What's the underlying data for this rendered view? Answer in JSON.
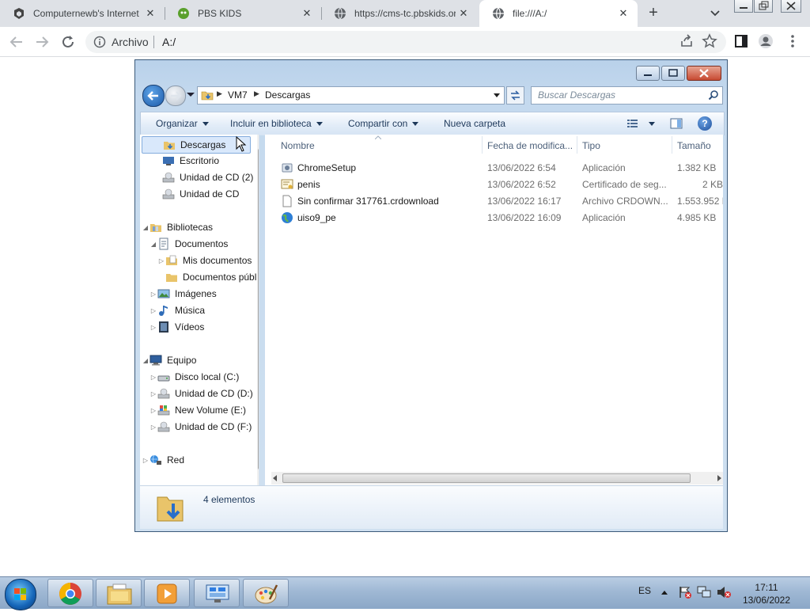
{
  "browser": {
    "tabs": [
      {
        "title": "Computernewb's Internet",
        "active": false
      },
      {
        "title": "PBS KIDS",
        "active": false
      },
      {
        "title": "https://cms-tc.pbskids.org",
        "active": false
      },
      {
        "title": "file:///A:/",
        "active": true
      }
    ],
    "address": {
      "scheme_label": "Archivo",
      "url": "A:/"
    }
  },
  "explorer": {
    "breadcrumb": [
      "VM7",
      "Descargas"
    ],
    "search_placeholder": "Buscar Descargas",
    "commands": [
      "Organizar",
      "Incluir en biblioteca",
      "Compartir con",
      "Nueva carpeta"
    ],
    "nav": [
      {
        "label": "Descargas",
        "icon": "downloads-folder-icon",
        "selected": true
      },
      {
        "label": "Escritorio",
        "icon": "desktop-icon"
      },
      {
        "label": "Unidad de CD (2)",
        "icon": "cd-drive-icon"
      },
      {
        "label": "Unidad de CD",
        "icon": "cd-drive-icon"
      },
      {
        "label": "Bibliotecas",
        "icon": "libraries-icon"
      },
      {
        "label": "Documentos",
        "icon": "documents-library-icon"
      },
      {
        "label": "Mis documentos",
        "icon": "documents-folder-icon"
      },
      {
        "label": "Documentos públicos",
        "icon": "folder-icon"
      },
      {
        "label": "Imágenes",
        "icon": "pictures-icon"
      },
      {
        "label": "Música",
        "icon": "music-icon"
      },
      {
        "label": "Vídeos",
        "icon": "videos-icon"
      },
      {
        "label": "Equipo",
        "icon": "computer-icon"
      },
      {
        "label": "Disco local (C:)",
        "icon": "hard-drive-icon"
      },
      {
        "label": "Unidad de CD (D:)",
        "icon": "cd-drive-icon"
      },
      {
        "label": "New Volume (E:)",
        "icon": "volume-icon"
      },
      {
        "label": "Unidad de CD (F:)",
        "icon": "cd-drive-icon"
      },
      {
        "label": "Red",
        "icon": "network-icon"
      }
    ],
    "columns": {
      "name": "Nombre",
      "date": "Fecha de modifica...",
      "type": "Tipo",
      "size": "Tamaño"
    },
    "files": [
      {
        "name": "ChromeSetup",
        "date": "13/06/2022 6:54",
        "type": "Aplicación",
        "size": "1.382 KB",
        "icon": "installer-icon"
      },
      {
        "name": "penis",
        "date": "13/06/2022 6:52",
        "type": "Certificado de seg...",
        "size": "2 KB",
        "icon": "certificate-icon"
      },
      {
        "name": "Sin confirmar 317761.crdownload",
        "date": "13/06/2022 16:17",
        "type": "Archivo CRDOWN...",
        "size": "1.553.952 KB",
        "icon": "blank-file-icon"
      },
      {
        "name": "uiso9_pe",
        "date": "13/06/2022 16:09",
        "type": "Aplicación",
        "size": "4.985 KB",
        "icon": "globe-app-icon"
      }
    ],
    "status": "4 elementos"
  },
  "taskbar": {
    "language": "ES",
    "time": "17:11",
    "date": "13/06/2022"
  }
}
